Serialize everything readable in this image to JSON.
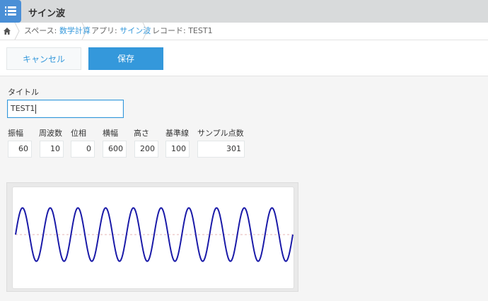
{
  "app": {
    "title": "サイン波",
    "icon": "app-list-icon"
  },
  "breadcrumb": {
    "home_icon": "home-icon",
    "space_prefix": "スペース: ",
    "space_name": "数学計算",
    "app_prefix": "アプリ: ",
    "app_name": "サイン波",
    "record_label": "レコード: TEST1"
  },
  "toolbar": {
    "cancel_label": "キャンセル",
    "save_label": "保存"
  },
  "form": {
    "title_label": "タイトル",
    "title_value": "TEST1",
    "fields": [
      {
        "label": "振幅",
        "value": "60"
      },
      {
        "label": "周波数",
        "value": "10"
      },
      {
        "label": "位相",
        "value": "0"
      },
      {
        "label": "横幅",
        "value": "600"
      },
      {
        "label": "高さ",
        "value": "200"
      },
      {
        "label": "基準線",
        "value": "100"
      },
      {
        "label": "サンプル点数",
        "value": "301"
      }
    ]
  },
  "colors": {
    "accent": "#3498db",
    "wave": "#1a1aa8",
    "baseline": "#e6b4b4"
  },
  "chart_data": {
    "type": "line",
    "series": [
      {
        "function": "sine",
        "amplitude": 60,
        "frequency": 10,
        "phase": 0,
        "width": 600,
        "height": 200,
        "baseline": 100,
        "samples": 301
      }
    ],
    "baseline_line": "dashed",
    "grid": false
  }
}
